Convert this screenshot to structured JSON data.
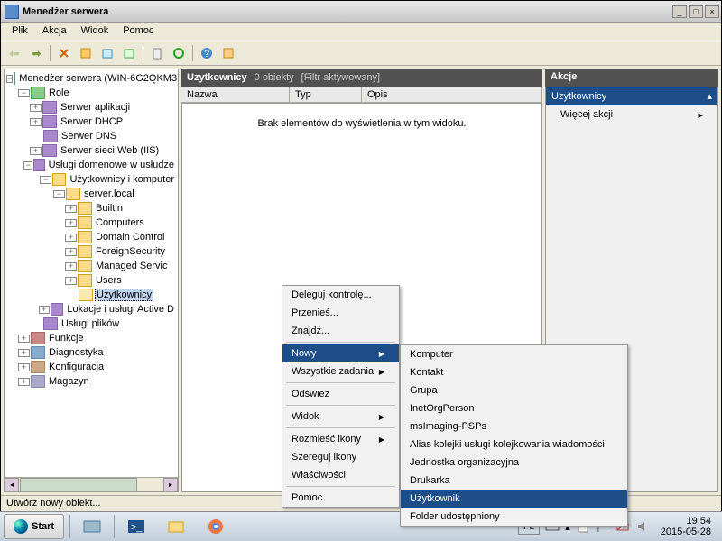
{
  "window": {
    "title": "Menedżer serwera"
  },
  "menubar": [
    "Plik",
    "Akcja",
    "Widok",
    "Pomoc"
  ],
  "tree": {
    "root": "Menedżer serwera (WIN-6G2QKM3",
    "role": "Role",
    "app_server": "Serwer aplikacji",
    "dhcp": "Serwer DHCP",
    "dns": "Serwer DNS",
    "iis": "Serwer sieci Web (IIS)",
    "domain_services": "Usługi domenowe w usłudze",
    "users_computers": "Użytkownicy i komputer",
    "server_local": "server.local",
    "builtin": "Builtin",
    "computers": "Computers",
    "domain_control": "Domain Control",
    "foreign_security": "ForeignSecurity",
    "managed_service": "Managed Servic",
    "users": "Users",
    "uzytkownicy": "Uzytkownicy",
    "ad_locations": "Lokacje i usługi Active D",
    "file_services": "Usługi plików",
    "functions": "Funkcje",
    "diagnostics": "Diagnostyka",
    "configuration": "Konfiguracja",
    "storage": "Magazyn"
  },
  "list": {
    "title": "Uzytkownicy",
    "obj_info": "0 obiekty",
    "filter": "[Filtr aktywowany]",
    "cols": {
      "name": "Nazwa",
      "type": "Typ",
      "desc": "Opis"
    },
    "empty": "Brak elementów do wyświetlenia w tym widoku."
  },
  "actions": {
    "header": "Akcje",
    "title": "Uzytkownicy",
    "more": "Więcej akcji"
  },
  "status": "Utwórz nowy obiekt...",
  "ctx1": {
    "delegate": "Deleguj kontrolę...",
    "move": "Przenieś...",
    "find": "Znajdź...",
    "new": "Nowy",
    "all_tasks": "Wszystkie zadania",
    "refresh": "Odśwież",
    "view": "Widok",
    "arrange": "Rozmieść ikony",
    "align": "Szereguj ikony",
    "properties": "Właściwości",
    "help": "Pomoc"
  },
  "ctx2": {
    "computer": "Komputer",
    "contact": "Kontakt",
    "group": "Grupa",
    "inetorg": "InetOrgPerson",
    "msimaging": "msImaging-PSPs",
    "queue_alias": "Alias kolejki usługi kolejkowania wiadomości",
    "org_unit": "Jednostka organizacyjna",
    "printer": "Drukarka",
    "user": "Użytkownik",
    "shared_folder": "Folder udostępniony"
  },
  "taskbar": {
    "start": "Start",
    "lang": "PL",
    "time": "19:54",
    "date": "2015-05-28"
  }
}
